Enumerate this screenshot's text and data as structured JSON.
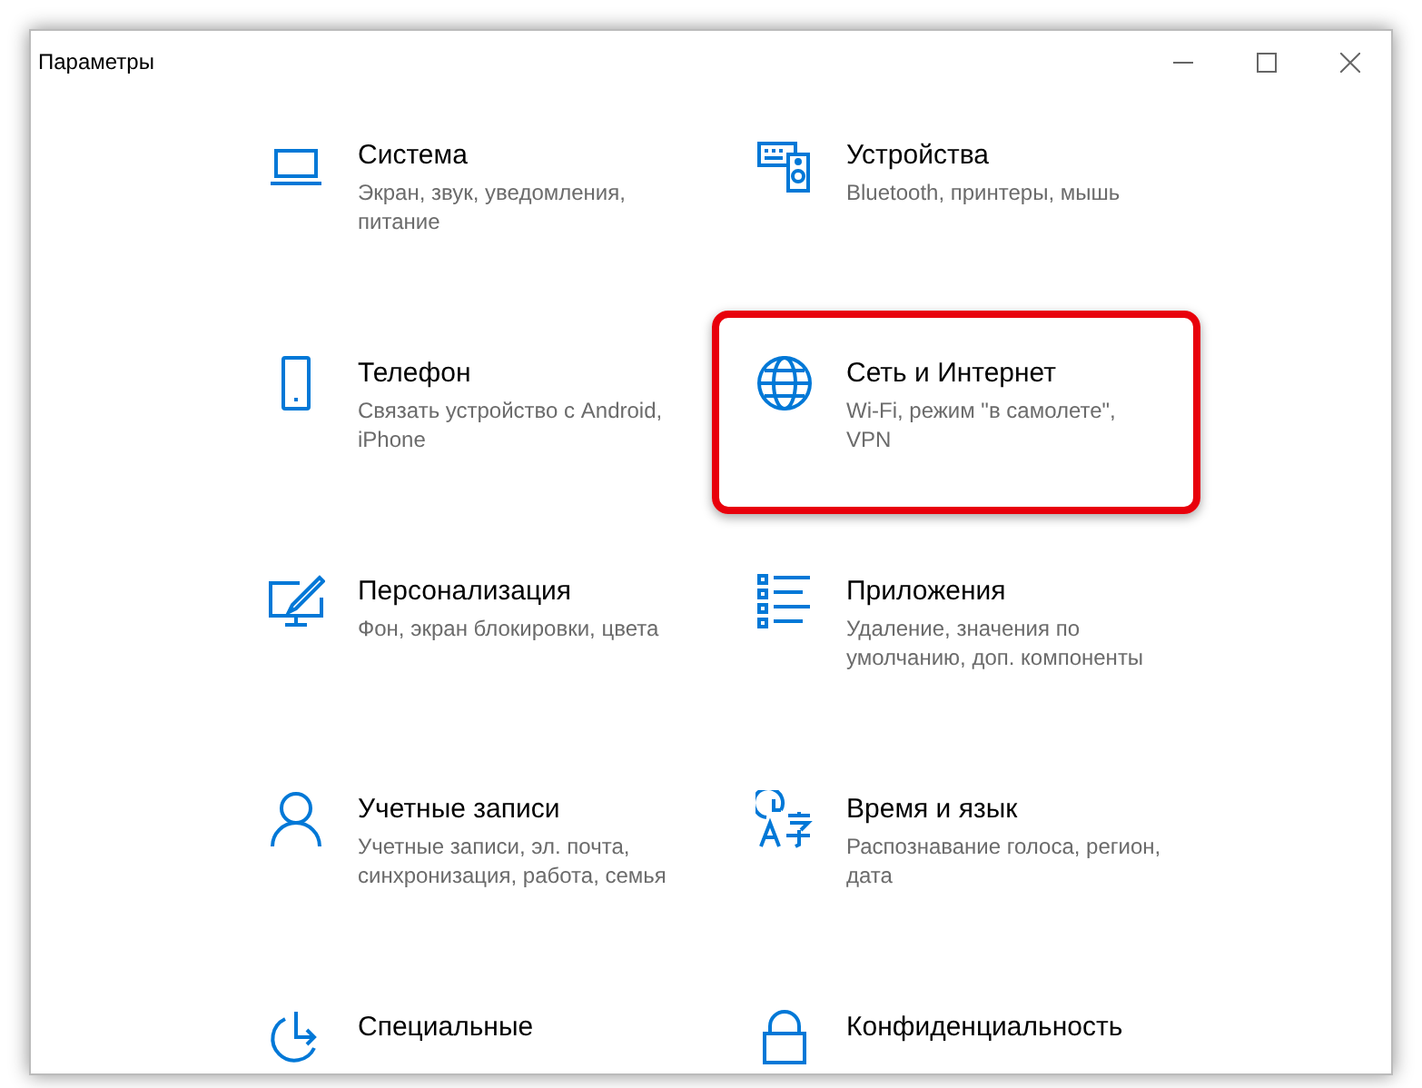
{
  "window": {
    "title": "Параметры"
  },
  "items": [
    {
      "kind": "laptop",
      "title": "Система",
      "description": "Экран, звук, уведомления, питание",
      "highlighted": false
    },
    {
      "kind": "devices",
      "title": "Устройства",
      "description": "Bluetooth, принтеры, мышь",
      "highlighted": false
    },
    {
      "kind": "phone",
      "title": "Телефон",
      "description": "Связать устройство с Android, iPhone",
      "highlighted": false
    },
    {
      "kind": "globe",
      "title": "Сеть и Интернет",
      "description": "Wi-Fi, режим \"в самолете\", VPN",
      "highlighted": true
    },
    {
      "kind": "paint",
      "title": "Персонализация",
      "description": "Фон, экран блокировки, цвета",
      "highlighted": false
    },
    {
      "kind": "list",
      "title": "Приложения",
      "description": "Удаление, значения по умолчанию, доп. компоненты",
      "highlighted": false
    },
    {
      "kind": "person",
      "title": "Учетные записи",
      "description": "Учетные записи, эл. почта, синхронизация, работа, семья",
      "highlighted": false
    },
    {
      "kind": "language",
      "title": "Время и язык",
      "description": "Распознавание голоса, регион, дата",
      "highlighted": false
    },
    {
      "kind": "accessibility",
      "title": "Специальные",
      "highlighted": false
    },
    {
      "kind": "lock",
      "title": "Конфиденциальность",
      "highlighted": false
    }
  ]
}
